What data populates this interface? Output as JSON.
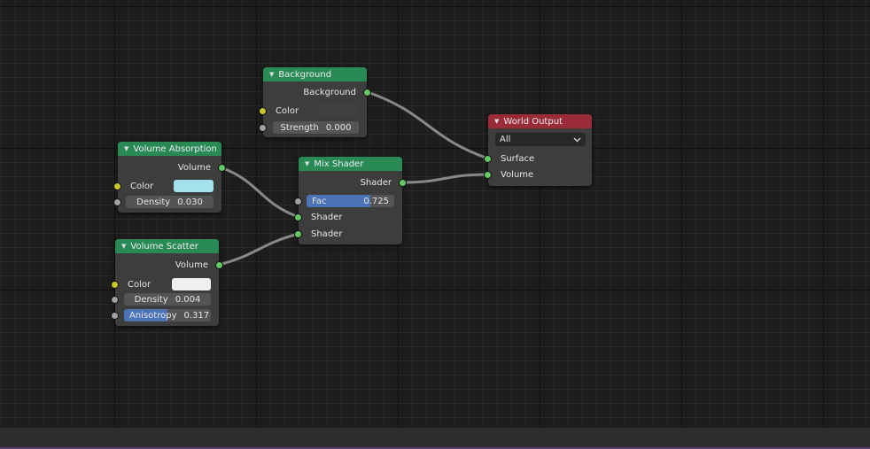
{
  "nodes": {
    "background": {
      "title": "Background",
      "output": "Background",
      "color_label": "Color",
      "strength_label": "Strength",
      "strength_value": "0.000",
      "color": "#404040"
    },
    "volume_absorption": {
      "title": "Volume Absorption",
      "output": "Volume",
      "color_label": "Color",
      "color": "#a2e2ec",
      "density_label": "Density",
      "density_value": "0.030"
    },
    "volume_scatter": {
      "title": "Volume Scatter",
      "output": "Volume",
      "color_label": "Color",
      "color": "#efefef",
      "density_label": "Density",
      "density_value": "0.004",
      "anisotropy_label": "Anisotropy",
      "anisotropy_value": "0.317",
      "anisotropy_fraction": 0.5
    },
    "mix_shader": {
      "title": "Mix Shader",
      "output": "Shader",
      "fac_label": "Fac",
      "fac_value": "0.725",
      "fac_fraction": 0.725,
      "input1": "Shader",
      "input2": "Shader"
    },
    "world_output": {
      "title": "World Output",
      "target": "All",
      "surface": "Surface",
      "volume": "Volume"
    }
  },
  "colors": {
    "shader_header": "#2a8a56",
    "output_header": "#9a2c3a",
    "shader_socket": "#63c763",
    "color_socket": "#c7c729",
    "value_socket": "#a1a1a1",
    "slider_fill": "#4b73b6"
  },
  "icons": {
    "collapse": "triangle-down-icon",
    "dropdown": "chevron-down-icon"
  }
}
